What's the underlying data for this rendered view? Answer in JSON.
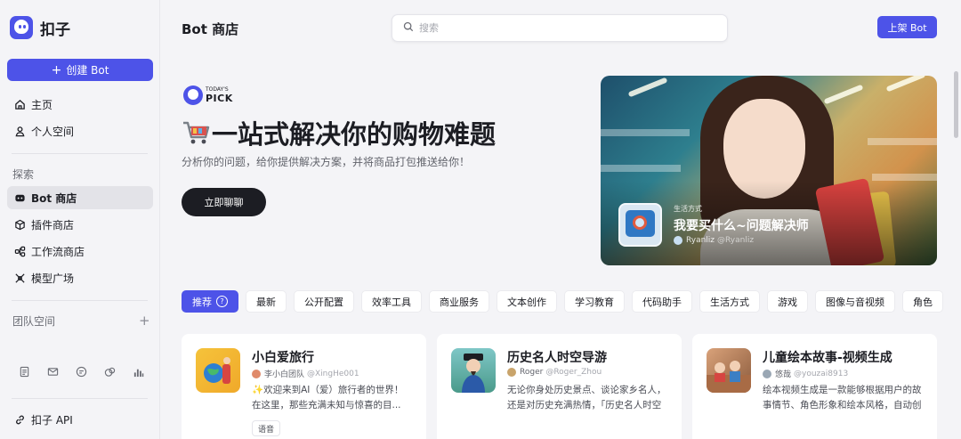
{
  "brand": {
    "name": "扣子"
  },
  "sidebar": {
    "create_label": "创建 Bot",
    "nav": [
      {
        "label": "主页",
        "icon": "home-icon"
      },
      {
        "label": "个人空间",
        "icon": "user-icon"
      }
    ],
    "explore_title": "探索",
    "explore": [
      {
        "label": "Bot 商店",
        "icon": "bot-icon",
        "active": true
      },
      {
        "label": "插件商店",
        "icon": "cube-icon"
      },
      {
        "label": "工作流商店",
        "icon": "workflow-icon"
      },
      {
        "label": "模型广场",
        "icon": "model-icon"
      }
    ],
    "team_title": "团队空间",
    "team_add": "+",
    "api_label": "扣子 API"
  },
  "header": {
    "title": "Bot 商店",
    "search_placeholder": "搜索",
    "publish_label": "上架 Bot"
  },
  "hero": {
    "pick_small": "TODAY'S",
    "pick_big": "PICK",
    "title": "一站式解决你的购物难题",
    "subtitle": "分析你的问题，给你提供解决方案，并将商品打包推送给你！",
    "cta_label": "立即聊聊",
    "card": {
      "category": "生活方式",
      "bot_name": "我要买什么~问题解决师",
      "author": "Ryanliz",
      "handle": "@Ryanliz"
    }
  },
  "tabs": {
    "items": [
      {
        "label": "推荐",
        "active": true,
        "help": "?"
      },
      {
        "label": "最新"
      },
      {
        "label": "公开配置"
      },
      {
        "label": "效率工具"
      },
      {
        "label": "商业服务"
      },
      {
        "label": "文本创作"
      },
      {
        "label": "学习教育"
      },
      {
        "label": "代码助手"
      },
      {
        "label": "生活方式"
      },
      {
        "label": "游戏"
      },
      {
        "label": "图像与音视频"
      },
      {
        "label": "角色"
      }
    ]
  },
  "cards": [
    {
      "title": "小白爱旅行",
      "author": "李小白团队",
      "handle": "@XingHe001",
      "desc": "✨欢迎来到AI（爱）旅行者的世界！在这里，那些充满未知与惊喜的目...",
      "tag": "语音"
    },
    {
      "title": "历史名人时空导游",
      "author": "Roger",
      "handle": "@Roger_Zhou",
      "desc": "无论你身处历史景点、谈论家乡名人，还是对历史充满热情，「历史名人时空导游」都能成为你的得力助..."
    },
    {
      "title": "儿童绘本故事-视频生成",
      "author": "悠哉",
      "handle": "@youzai8913",
      "desc": "绘本视频生成是一款能够根据用户的故事情节、角色形象和绘本风格，自动创作并输出绘本视频的对话机器..."
    }
  ],
  "colors": {
    "accent": "#4d53e8",
    "dark": "#1c1d23",
    "bg": "#f4f4f7"
  }
}
